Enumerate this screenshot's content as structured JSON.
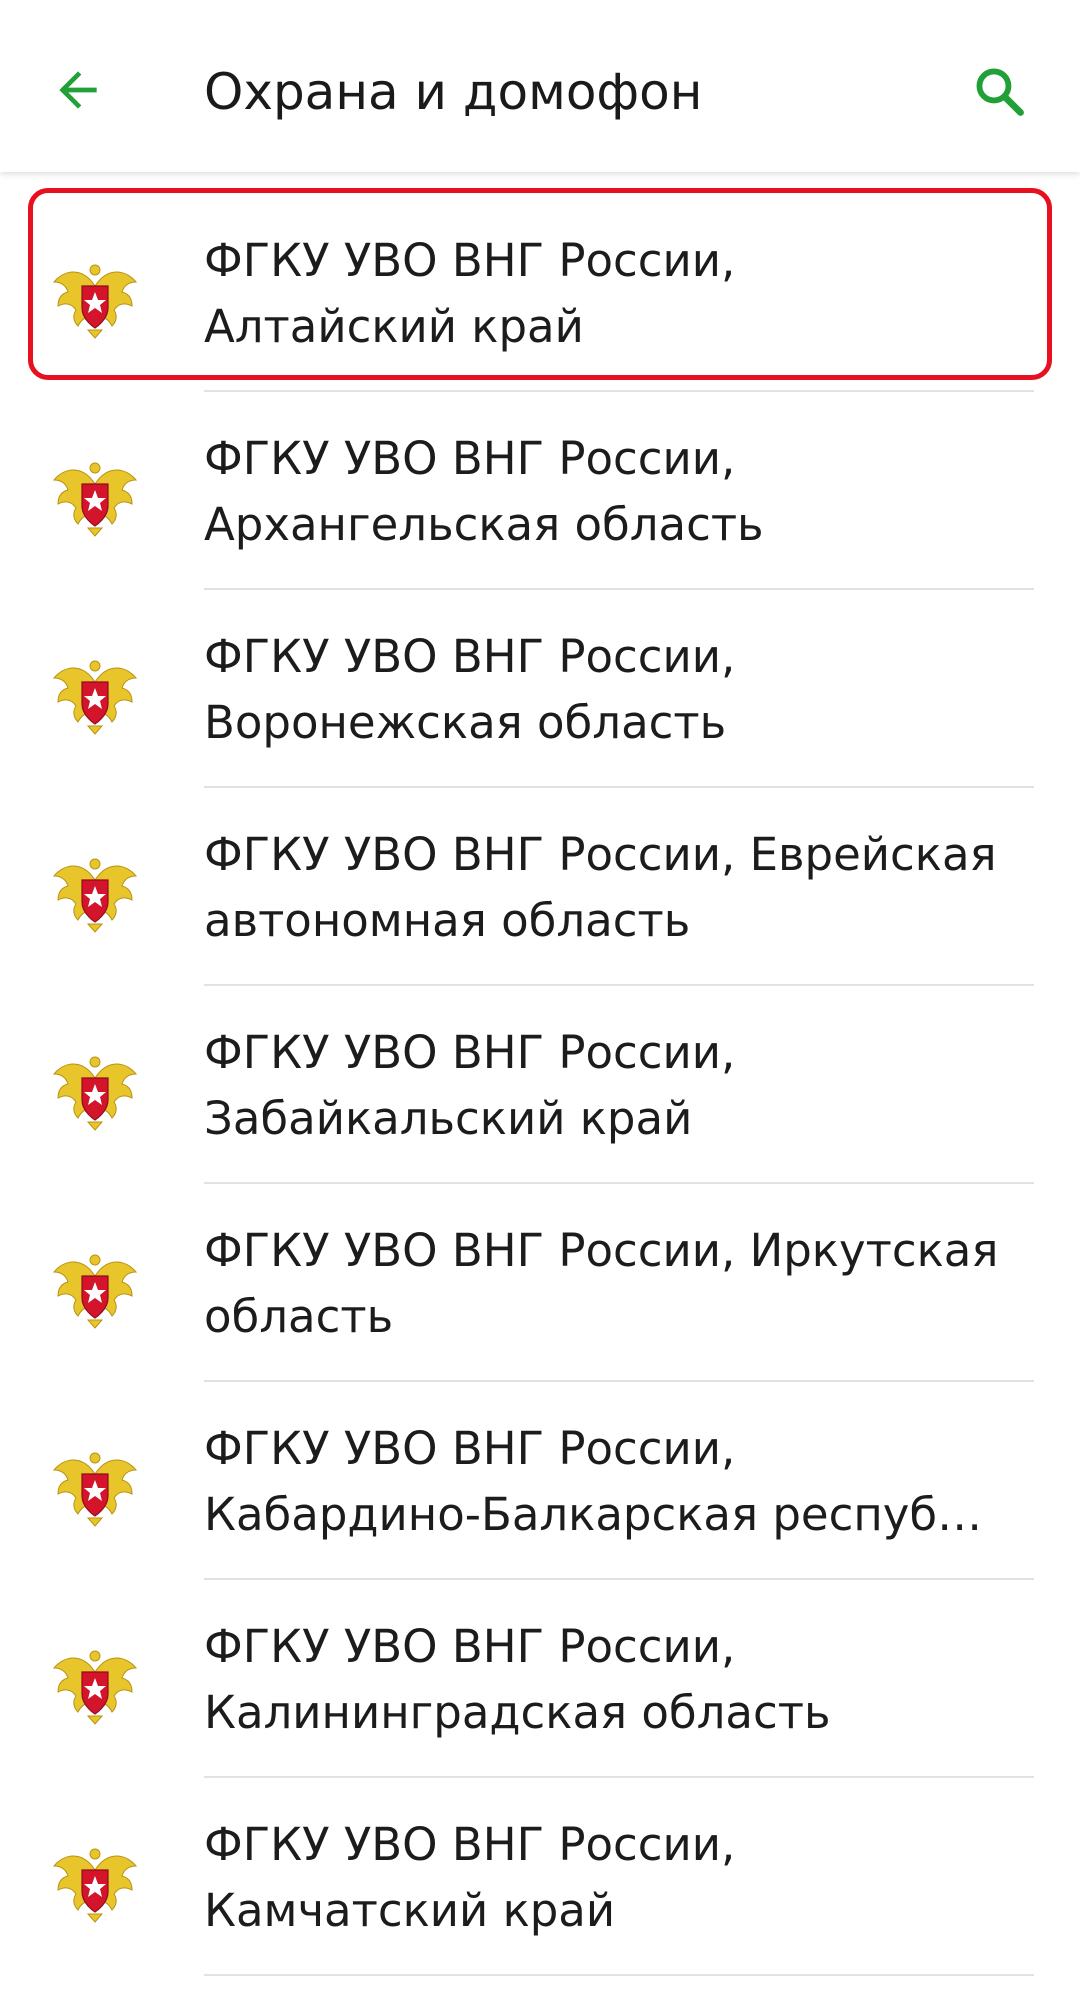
{
  "header": {
    "title": "Охрана и домофон",
    "back_icon": "arrow-left-icon",
    "search_icon": "search-icon",
    "accent_color": "#21A038"
  },
  "highlight_color": "#E8101E",
  "items": [
    {
      "line1": "ФГКУ УВО ВНГ России,",
      "line2": "Алтайский край",
      "icon": "rosgvardia-emblem-icon"
    },
    {
      "line1": "ФГКУ УВО ВНГ России,",
      "line2": "Архангельская область",
      "icon": "rosgvardia-emblem-icon"
    },
    {
      "line1": "ФГКУ УВО ВНГ России,",
      "line2": "Воронежская область",
      "icon": "rosgvardia-emblem-icon"
    },
    {
      "line1": "ФГКУ УВО ВНГ России, Еврейская",
      "line2": "автономная область",
      "icon": "rosgvardia-emblem-icon"
    },
    {
      "line1": "ФГКУ УВО ВНГ России,",
      "line2": "Забайкальский край",
      "icon": "rosgvardia-emblem-icon"
    },
    {
      "line1": "ФГКУ УВО ВНГ России, Иркутская",
      "line2": "область",
      "icon": "rosgvardia-emblem-icon"
    },
    {
      "line1": "ФГКУ УВО ВНГ России,",
      "line2": "Кабардино-Балкарская респуб…",
      "icon": "rosgvardia-emblem-icon"
    },
    {
      "line1": "ФГКУ УВО ВНГ России,",
      "line2": "Калининградская область",
      "icon": "rosgvardia-emblem-icon"
    },
    {
      "line1": "ФГКУ УВО ВНГ России,",
      "line2": "Камчатский край",
      "icon": "rosgvardia-emblem-icon"
    }
  ]
}
